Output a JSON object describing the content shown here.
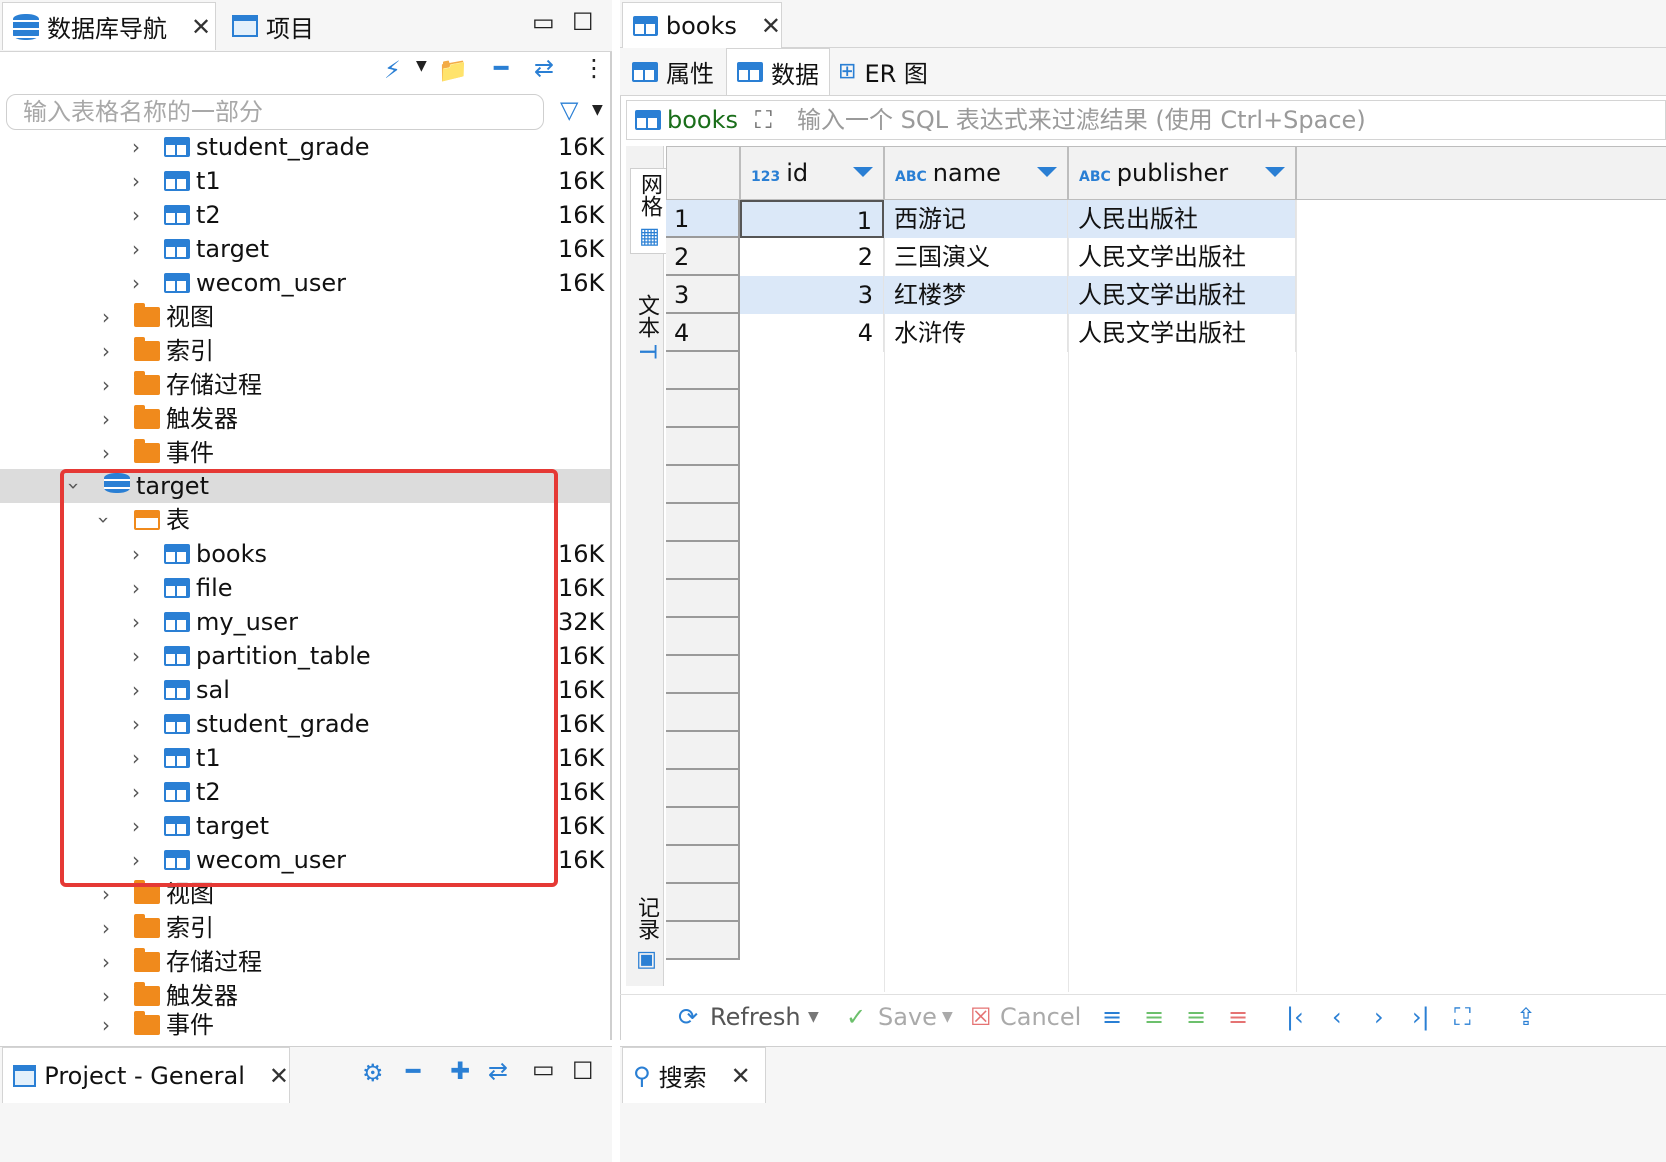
{
  "left_panel": {
    "tabs": [
      {
        "label": "数据库导航"
      },
      {
        "label": "项目"
      }
    ],
    "search_placeholder": "输入表格名称的一部分",
    "tree_above": [
      {
        "label": "student_grade",
        "size": "16K"
      },
      {
        "label": "t1",
        "size": "16K"
      },
      {
        "label": "t2",
        "size": "16K"
      },
      {
        "label": "target",
        "size": "16K"
      },
      {
        "label": "wecom_user",
        "size": "16K"
      }
    ],
    "folders_above": [
      "视图",
      "索引",
      "存储过程",
      "触发器",
      "事件"
    ],
    "database": {
      "label": "target",
      "tables_folder": "表"
    },
    "tables": [
      {
        "label": "books",
        "size": "16K"
      },
      {
        "label": "file",
        "size": "16K"
      },
      {
        "label": "my_user",
        "size": "32K"
      },
      {
        "label": "partition_table",
        "size": "16K"
      },
      {
        "label": "sal",
        "size": "16K"
      },
      {
        "label": "student_grade",
        "size": "16K"
      },
      {
        "label": "t1",
        "size": "16K"
      },
      {
        "label": "t2",
        "size": "16K"
      },
      {
        "label": "target",
        "size": "16K"
      },
      {
        "label": "wecom_user",
        "size": "16K"
      }
    ],
    "folders_below": [
      "视图",
      "索引",
      "存储过程",
      "触发器",
      "事件"
    ],
    "bottom_tab": "Project - General"
  },
  "right_panel": {
    "editor_tab": "books",
    "subtabs": [
      "属性",
      "数据",
      "ER 图"
    ],
    "filter": {
      "table": "books",
      "placeholder": "输入一个 SQL 表达式来过滤结果 (使用 Ctrl+Space)"
    },
    "side_labels": {
      "grid": "网格",
      "text": "文本",
      "record": "记录"
    },
    "columns": [
      {
        "badge": "123",
        "name": "id"
      },
      {
        "badge": "ABC",
        "name": "name"
      },
      {
        "badge": "ABC",
        "name": "publisher"
      }
    ],
    "rows": [
      {
        "n": "1",
        "id": "1",
        "name": "西游记",
        "publisher": "人民出版社"
      },
      {
        "n": "2",
        "id": "2",
        "name": "三国演义",
        "publisher": "人民文学出版社"
      },
      {
        "n": "3",
        "id": "3",
        "name": "红楼梦",
        "publisher": "人民文学出版社"
      },
      {
        "n": "4",
        "id": "4",
        "name": "水浒传",
        "publisher": "人民文学出版社"
      }
    ],
    "toolbar": {
      "refresh": "Refresh",
      "save": "Save",
      "cancel": "Cancel"
    },
    "bottom_tab": "搜索"
  },
  "colors": {
    "accent": "#2a7fd4",
    "highlight": "#e53935",
    "folder": "#f08a1c"
  }
}
